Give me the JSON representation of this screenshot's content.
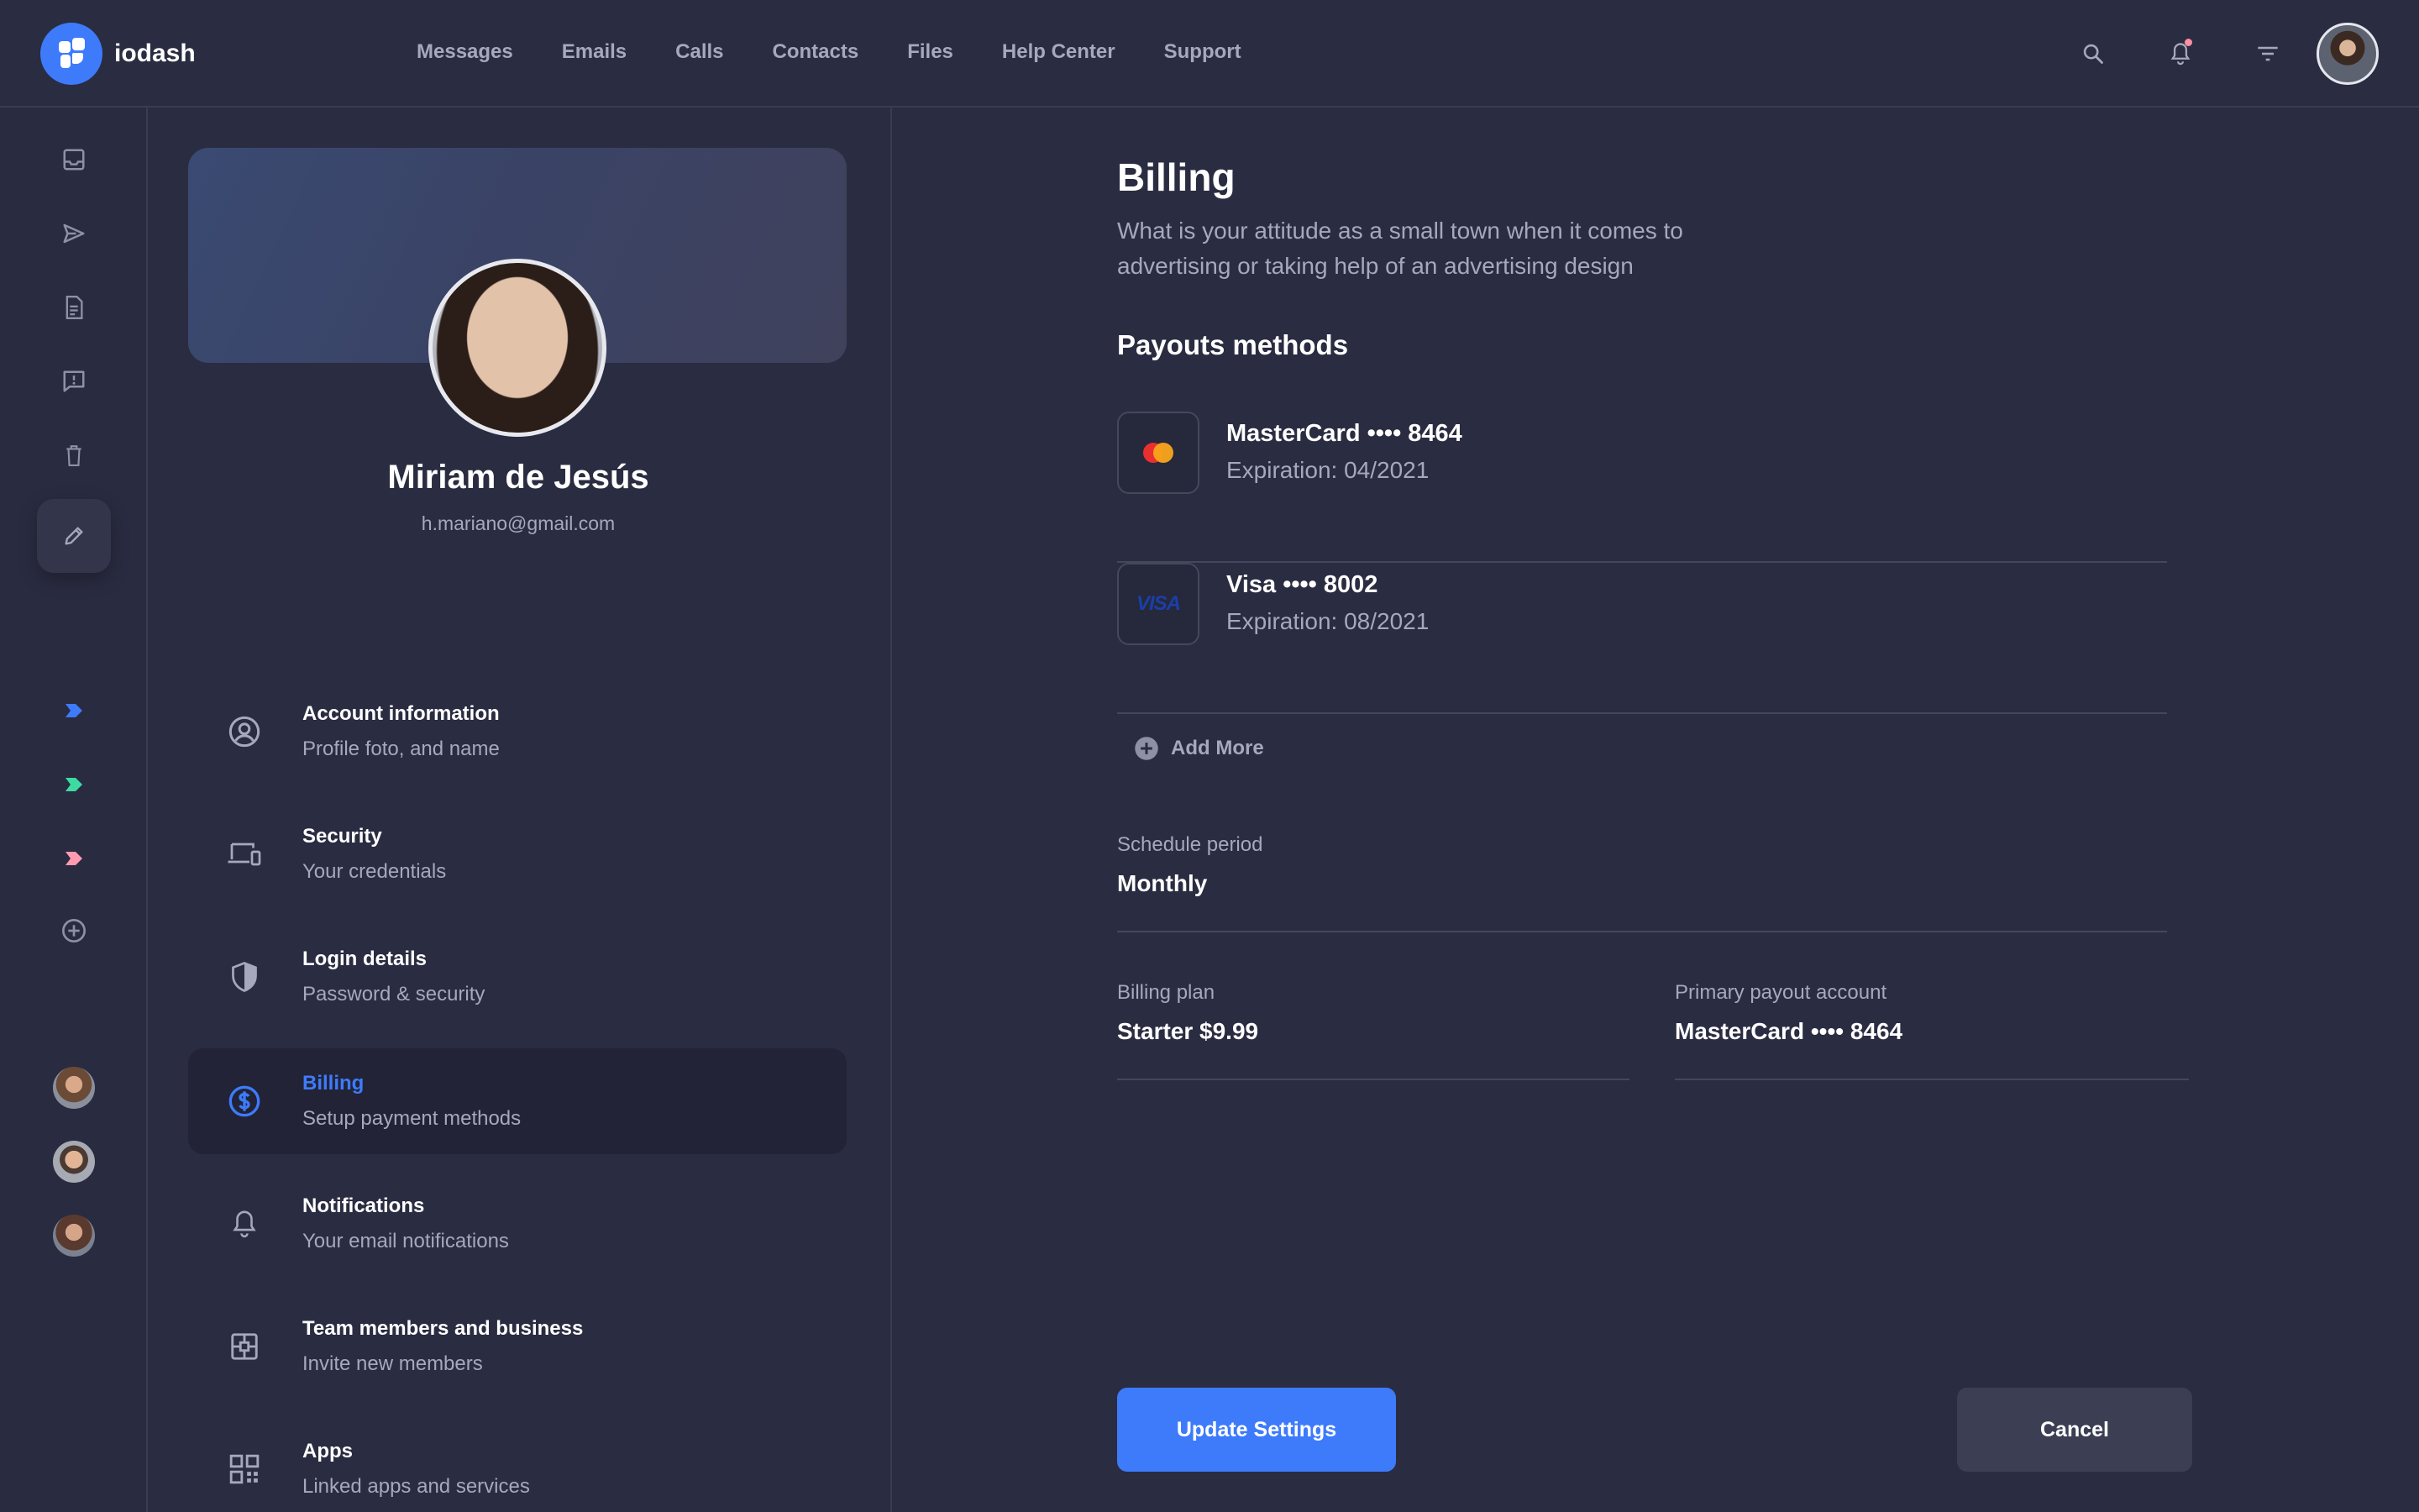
{
  "app": {
    "name": "iodash"
  },
  "nav": [
    "Messages",
    "Emails",
    "Calls",
    "Contacts",
    "Files",
    "Help Center",
    "Support"
  ],
  "colors": {
    "accent": "#3d7bfb",
    "background": "#2a2c41",
    "muted_text": "#a6a8bb",
    "notification_dot": "#ff8fa3",
    "label_blue": "#3d7bfb",
    "label_green": "#3ddba0",
    "label_pink": "#ff9bb1"
  },
  "top_icons": [
    "search-icon",
    "bell-icon",
    "filter-icon"
  ],
  "rail_icons": [
    "inbox-icon",
    "send-icon",
    "document-icon",
    "report-icon",
    "trash-icon",
    "pencil-icon",
    "blue-label-icon",
    "green-label-icon",
    "pink-label-icon",
    "add-circle-icon"
  ],
  "profile": {
    "name": "Miriam de Jesús",
    "email": "h.mariano@gmail.com"
  },
  "menu": [
    {
      "title": "Account information",
      "subtitle": "Profile foto, and name",
      "icon": "user-circle-icon"
    },
    {
      "title": "Security",
      "subtitle": "Your credentials",
      "icon": "devices-icon"
    },
    {
      "title": "Login details",
      "subtitle": "Password & security",
      "icon": "shield-icon"
    },
    {
      "title": "Billing",
      "subtitle": "Setup payment methods",
      "icon": "dollar-circle-icon",
      "active": true
    },
    {
      "title": "Notifications",
      "subtitle": "Your email notifications",
      "icon": "bell-icon"
    },
    {
      "title": "Team members and business",
      "subtitle": "Invite new members",
      "icon": "team-icon"
    },
    {
      "title": "Apps",
      "subtitle": "Linked apps and services",
      "icon": "qr-code-icon"
    }
  ],
  "billing": {
    "title": "Billing",
    "description": "What is your attitude as a small town when it comes to advertising or taking help of an advertising design",
    "payouts_title": "Payouts methods",
    "cards": [
      {
        "name": "MasterCard •••• 8464",
        "expiration": "Expiration: 04/2021",
        "brand": "mastercard"
      },
      {
        "name": "Visa •••• 8002",
        "expiration": "Expiration: 08/2021",
        "brand": "visa",
        "logo_text": "VISA"
      }
    ],
    "add_more": "Add More",
    "schedule": {
      "label": "Schedule period",
      "value": "Monthly"
    },
    "plan": {
      "label": "Billing plan",
      "value": "Starter $9.99"
    },
    "payout_account": {
      "label": "Primary payout account",
      "value": "MasterCard •••• 8464"
    },
    "update_button": "Update Settings",
    "cancel_button": "Cancel"
  }
}
